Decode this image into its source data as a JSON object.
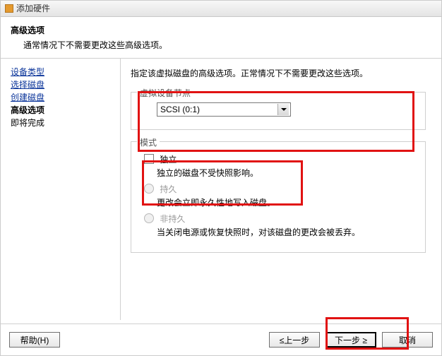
{
  "window": {
    "title": "添加硬件"
  },
  "header": {
    "title": "高级选项",
    "subtitle": "通常情况下不需要更改这些高级选项。"
  },
  "sidebar": {
    "items": [
      {
        "label": "设备类型",
        "link": true
      },
      {
        "label": "选择磁盘",
        "link": true
      },
      {
        "label": "创建磁盘",
        "link": true
      },
      {
        "label": "高级选项",
        "current": true
      },
      {
        "label": "即将完成",
        "plain": true
      }
    ]
  },
  "content": {
    "description": "指定该虚拟磁盘的高级选项。正常情况下不需要更改这些选项。",
    "group_node": {
      "legend": "虚拟设备节点",
      "select_value": "SCSI (0:1)"
    },
    "group_mode": {
      "legend": "模式",
      "independent": {
        "label": "独立",
        "desc": "独立的磁盘不受快照影响。"
      },
      "persistent": {
        "label": "持久",
        "desc": "更改会立即永久性地写入磁盘。"
      },
      "nonpersistent": {
        "label": "非持久",
        "desc": "当关闭电源或恢复快照时，对该磁盘的更改会被丢弃。"
      }
    }
  },
  "footer": {
    "help": "帮助(H)",
    "back": "≤上一步",
    "next": "下一步 ≥",
    "cancel": "取消"
  }
}
